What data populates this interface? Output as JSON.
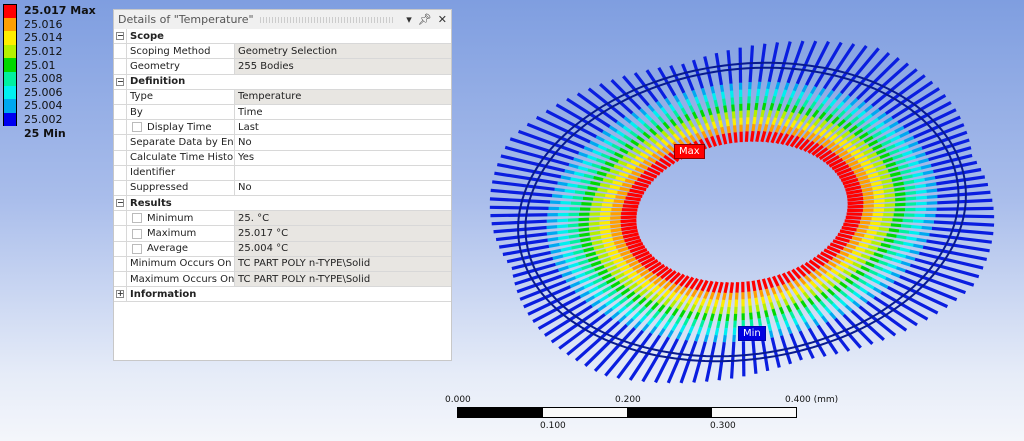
{
  "legend": {
    "items": [
      {
        "label": "25.017 Max",
        "color": "#ff0000",
        "bold": true
      },
      {
        "label": "25.016",
        "color": "#ff9f00"
      },
      {
        "label": "25.014",
        "color": "#ffee00"
      },
      {
        "label": "25.012",
        "color": "#b4f000"
      },
      {
        "label": "25.01",
        "color": "#00d800"
      },
      {
        "label": "25.008",
        "color": "#00f0a0"
      },
      {
        "label": "25.006",
        "color": "#00f0f0"
      },
      {
        "label": "25.004",
        "color": "#00a8f0"
      },
      {
        "label": "25.002",
        "color": "#0000f0"
      },
      {
        "label": "25 Min",
        "color": "#0000f0",
        "bold": true
      }
    ]
  },
  "panel": {
    "title": "Details of \"Temperature\"",
    "icons": [
      "dropdown-icon",
      "pin-icon",
      "close-icon"
    ],
    "groups": [
      {
        "name": "Scope",
        "expanded": true,
        "rows": [
          {
            "k": "Scoping Method",
            "v": "Geometry Selection",
            "gray": true
          },
          {
            "k": "Geometry",
            "v": "255 Bodies",
            "gray": true
          }
        ]
      },
      {
        "name": "Definition",
        "expanded": true,
        "rows": [
          {
            "k": "Type",
            "v": "Temperature",
            "gray": true
          },
          {
            "k": "By",
            "v": "Time"
          },
          {
            "k": "Display Time",
            "v": "Last",
            "cb": true
          },
          {
            "k": "Separate Data by Entity",
            "v": "No"
          },
          {
            "k": "Calculate Time History",
            "v": "Yes"
          },
          {
            "k": "Identifier",
            "v": ""
          },
          {
            "k": "Suppressed",
            "v": "No"
          }
        ]
      },
      {
        "name": "Results",
        "expanded": true,
        "rows": [
          {
            "k": "Minimum",
            "v": "25. °C",
            "cb": true,
            "gray": true
          },
          {
            "k": "Maximum",
            "v": "25.017 °C",
            "cb": true,
            "gray": true
          },
          {
            "k": "Average",
            "v": "25.004 °C",
            "cb": true,
            "gray": true
          },
          {
            "k": "Minimum Occurs On",
            "v": "TC PART POLY n-TYPE\\Solid",
            "gray": true
          },
          {
            "k": "Maximum Occurs On",
            "v": "TC PART POLY n-TYPE\\Solid",
            "gray": true
          }
        ]
      },
      {
        "name": "Information",
        "expanded": false,
        "rows": []
      }
    ]
  },
  "viewport": {
    "max_label": "Max",
    "min_label": "Min",
    "max_color": "#ff0000",
    "min_color": "#0000e0"
  },
  "scale_bar": {
    "top": [
      "0.000",
      "0.200",
      "0.400 (mm)"
    ],
    "bottom": [
      "0.100",
      "0.300"
    ]
  }
}
